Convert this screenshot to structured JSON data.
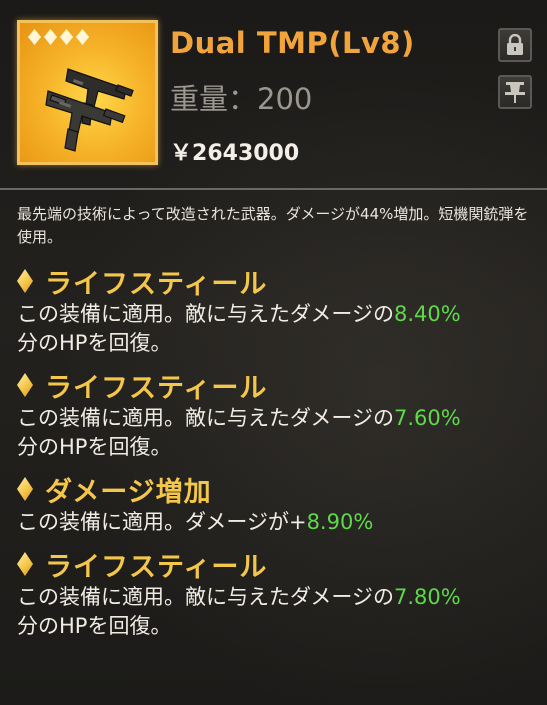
{
  "item": {
    "name": "Dual TMP(Lv8)",
    "weight_label": "重量：200",
    "price_symbol": "￥",
    "price": "2643000",
    "rarity_stars": 4,
    "icon": "dual-smg-icon",
    "frame_color": "#f3c25a"
  },
  "buttons": {
    "lock_icon": "lock-icon",
    "pin_icon": "pin-icon"
  },
  "description": "最先端の技術によって改造された武器。ダメージが44%増加。短機関銃弾を使用。",
  "effects": [
    {
      "name": "ライフスティール",
      "text_before": "この装備に適用。敵に与えたダメージの",
      "value": "8.40%",
      "text_after": "分のHPを回復。"
    },
    {
      "name": "ライフスティール",
      "text_before": "この装備に適用。敵に与えたダメージの",
      "value": "7.60%",
      "text_after": "分のHPを回復。"
    },
    {
      "name": "ダメージ増加",
      "text_before": "この装備に適用。ダメージが",
      "sign": "+",
      "value": "8.90%",
      "text_after": ""
    },
    {
      "name": "ライフスティール",
      "text_before": "この装備に適用。敵に与えたダメージの",
      "value": "7.80%",
      "text_after": "分のHPを回復。"
    }
  ],
  "colors": {
    "title": "#f2a43c",
    "effect_name": "#f4c64a",
    "value_green": "#5ed94a"
  }
}
